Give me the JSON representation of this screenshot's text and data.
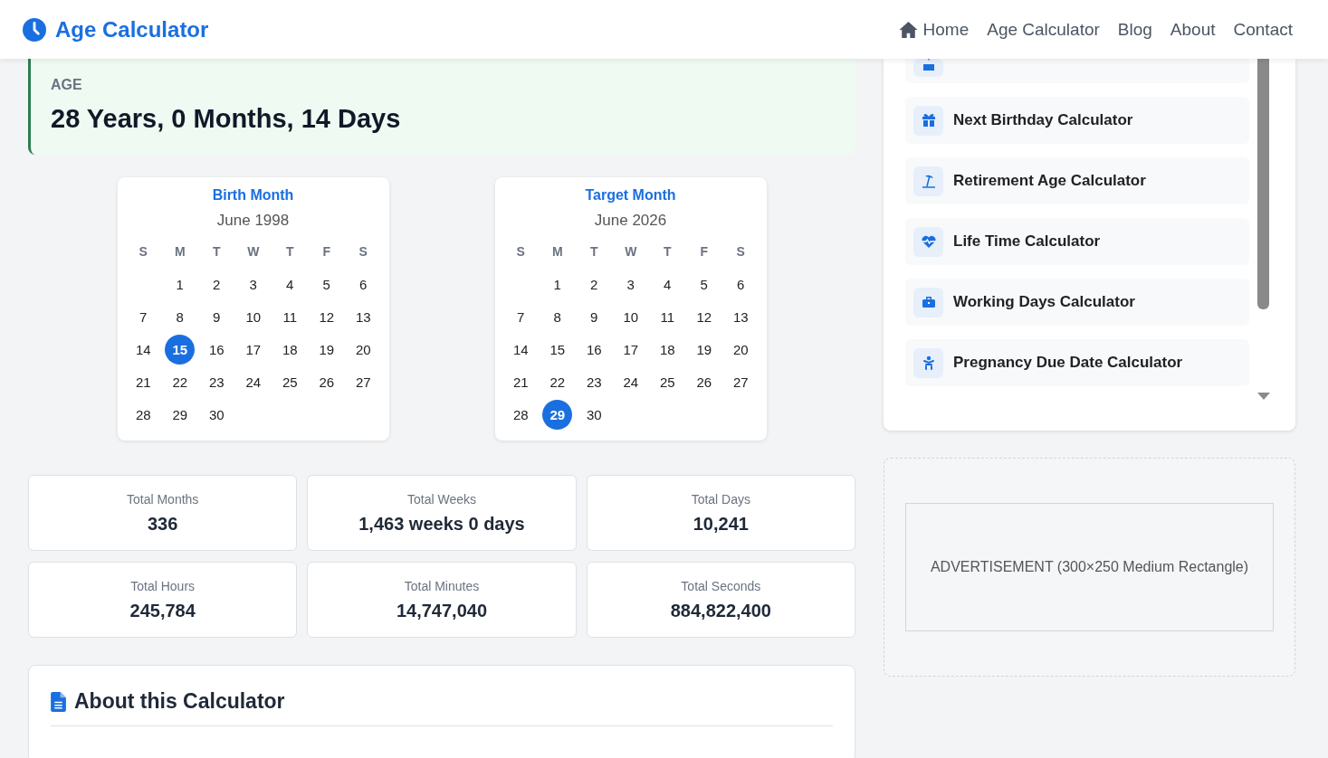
{
  "header": {
    "logo": "Age Calculator",
    "nav": [
      {
        "label": "Home"
      },
      {
        "label": "Age Calculator"
      },
      {
        "label": "Blog"
      },
      {
        "label": "About"
      },
      {
        "label": "Contact"
      }
    ]
  },
  "age": {
    "label": "AGE",
    "value": "28 Years, 0 Months, 14 Days"
  },
  "calendars": [
    {
      "title": "Birth Month",
      "month": "June 1998",
      "weekdays": [
        "S",
        "M",
        "T",
        "W",
        "T",
        "F",
        "S"
      ],
      "weeks": [
        {
          "kind": "lead",
          "days": [
            {
              "day": "1",
              "selected": false
            },
            {
              "day": "2",
              "selected": false
            },
            {
              "day": "3",
              "selected": false
            },
            {
              "day": "4",
              "selected": false
            },
            {
              "day": "5",
              "selected": false
            },
            {
              "day": "6",
              "selected": false
            }
          ]
        },
        {
          "kind": "full",
          "days": [
            {
              "day": "7",
              "selected": false
            },
            {
              "day": "8",
              "selected": false
            },
            {
              "day": "9",
              "selected": false
            },
            {
              "day": "10",
              "selected": false
            },
            {
              "day": "11",
              "selected": false
            },
            {
              "day": "12",
              "selected": false
            },
            {
              "day": "13",
              "selected": false
            }
          ]
        },
        {
          "kind": "full",
          "days": [
            {
              "day": "14",
              "selected": false
            },
            {
              "day": "15",
              "selected": true
            },
            {
              "day": "16",
              "selected": false
            },
            {
              "day": "17",
              "selected": false
            },
            {
              "day": "18",
              "selected": false
            },
            {
              "day": "19",
              "selected": false
            },
            {
              "day": "20",
              "selected": false
            }
          ]
        },
        {
          "kind": "full",
          "days": [
            {
              "day": "21",
              "selected": false
            },
            {
              "day": "22",
              "selected": false
            },
            {
              "day": "23",
              "selected": false
            },
            {
              "day": "24",
              "selected": false
            },
            {
              "day": "25",
              "selected": false
            },
            {
              "day": "26",
              "selected": false
            },
            {
              "day": "27",
              "selected": false
            }
          ]
        },
        {
          "kind": "trail",
          "days": [
            {
              "day": "28",
              "selected": false
            },
            {
              "day": "29",
              "selected": false
            },
            {
              "day": "30",
              "selected": false
            }
          ]
        }
      ]
    },
    {
      "title": "Target Month",
      "month": "June 2026",
      "weekdays": [
        "S",
        "M",
        "T",
        "W",
        "T",
        "F",
        "S"
      ],
      "weeks": [
        {
          "kind": "lead",
          "days": [
            {
              "day": "1",
              "selected": false
            },
            {
              "day": "2",
              "selected": false
            },
            {
              "day": "3",
              "selected": false
            },
            {
              "day": "4",
              "selected": false
            },
            {
              "day": "5",
              "selected": false
            },
            {
              "day": "6",
              "selected": false
            }
          ]
        },
        {
          "kind": "full",
          "days": [
            {
              "day": "7",
              "selected": false
            },
            {
              "day": "8",
              "selected": false
            },
            {
              "day": "9",
              "selected": false
            },
            {
              "day": "10",
              "selected": false
            },
            {
              "day": "11",
              "selected": false
            },
            {
              "day": "12",
              "selected": false
            },
            {
              "day": "13",
              "selected": false
            }
          ]
        },
        {
          "kind": "full",
          "days": [
            {
              "day": "14",
              "selected": false
            },
            {
              "day": "15",
              "selected": false
            },
            {
              "day": "16",
              "selected": false
            },
            {
              "day": "17",
              "selected": false
            },
            {
              "day": "18",
              "selected": false
            },
            {
              "day": "19",
              "selected": false
            },
            {
              "day": "20",
              "selected": false
            }
          ]
        },
        {
          "kind": "full",
          "days": [
            {
              "day": "21",
              "selected": false
            },
            {
              "day": "22",
              "selected": false
            },
            {
              "day": "23",
              "selected": false
            },
            {
              "day": "24",
              "selected": false
            },
            {
              "day": "25",
              "selected": false
            },
            {
              "day": "26",
              "selected": false
            },
            {
              "day": "27",
              "selected": false
            }
          ]
        },
        {
          "kind": "trail",
          "days": [
            {
              "day": "28",
              "selected": false
            },
            {
              "day": "29",
              "selected": true
            },
            {
              "day": "30",
              "selected": false
            }
          ]
        }
      ]
    }
  ],
  "stats": [
    {
      "label": "Total Months",
      "value": "336"
    },
    {
      "label": "Total Weeks",
      "value": "1,463 weeks 0 days"
    },
    {
      "label": "Total Days",
      "value": "10,241"
    },
    {
      "label": "Total Hours",
      "value": "245,784"
    },
    {
      "label": "Total Minutes",
      "value": "14,747,040"
    },
    {
      "label": "Total Seconds",
      "value": "884,822,400"
    }
  ],
  "about": {
    "title": "About this Calculator"
  },
  "sidebar": {
    "items": [
      {
        "label": "Next Birthday Calculator"
      },
      {
        "label": "Retirement Age Calculator"
      },
      {
        "label": "Life Time Calculator"
      },
      {
        "label": "Working Days Calculator"
      },
      {
        "label": "Pregnancy Due Date Calculator"
      }
    ]
  },
  "ad": {
    "text": "ADVERTISEMENT (300×250 Medium Rectangle)"
  }
}
